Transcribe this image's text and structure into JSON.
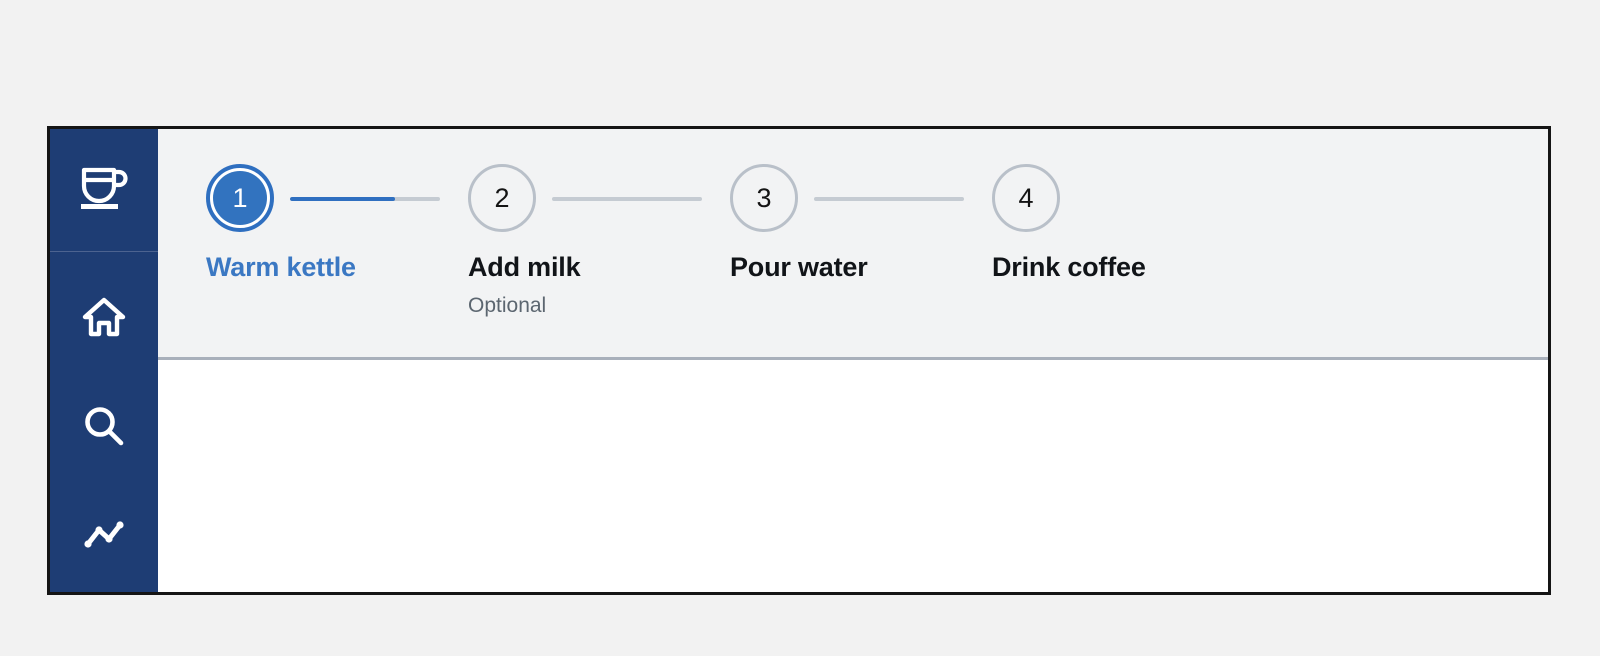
{
  "theme": {
    "page_background": "#f2f2f2",
    "sidebar_background": "#1e3d74",
    "header_background": "#f2f3f4",
    "content_background": "#ffffff",
    "accent_blue": "#2f6fc0",
    "active_circle_fill": "#3273bf",
    "active_label_color": "#3b78c3",
    "inactive_circle_border": "#b9c0c9",
    "connector_gray": "#c5cbd2",
    "caption_gray": "#5c6670",
    "frame_border": "#151515",
    "header_divider": "#a9b0bb"
  },
  "sidebar": {
    "logo": {
      "icon": "coffee-cup-icon",
      "label": ""
    },
    "items": [
      {
        "icon": "home-icon",
        "label": ""
      },
      {
        "icon": "search-icon",
        "label": ""
      },
      {
        "icon": "analytics-line-chart-icon",
        "label": ""
      }
    ]
  },
  "stepper": {
    "active_index": 0,
    "connector_progress_percent": 70,
    "steps": [
      {
        "number": "1",
        "label": "Warm kettle",
        "caption": "",
        "state": "active"
      },
      {
        "number": "2",
        "label": "Add milk",
        "caption": "Optional",
        "state": "inactive"
      },
      {
        "number": "3",
        "label": "Pour water",
        "caption": "",
        "state": "inactive"
      },
      {
        "number": "4",
        "label": "Drink coffee",
        "caption": "",
        "state": "inactive"
      }
    ]
  },
  "content": {
    "body_text": ""
  }
}
